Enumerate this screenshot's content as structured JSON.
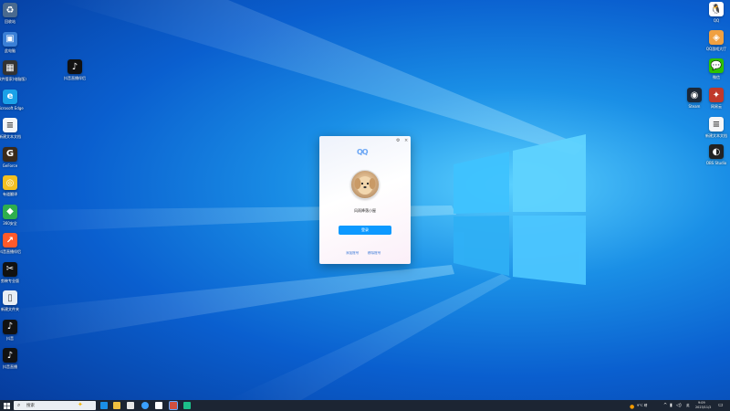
{
  "desktop_left": [
    {
      "label": "回收站",
      "color": "#4a6a8f",
      "glyph": "♻"
    },
    {
      "label": "此电脑",
      "color": "#3a7fd6",
      "glyph": "▣"
    },
    {
      "label": "Lo软件管家(电脑版)",
      "color": "#333333",
      "glyph": "▦"
    },
    {
      "label": "Microsoft Edge",
      "color": "#1aa1e8",
      "glyph": "e"
    },
    {
      "label": "新建文本文档",
      "color": "#f4f6f8",
      "glyph": "≡"
    },
    {
      "label": "GeForce",
      "color": "#3a2a1a",
      "glyph": "G"
    },
    {
      "label": "有道翻译",
      "color": "#f4c020",
      "glyph": "◎"
    },
    {
      "label": "360安全",
      "color": "#2fae4e",
      "glyph": "◆"
    },
    {
      "label": "抖音直播伴侣",
      "color": "#ff5a2a",
      "glyph": "↗"
    },
    {
      "label": "剪映专业版",
      "color": "#111111",
      "glyph": "✂"
    },
    {
      "label": "新建文件夹",
      "color": "#e8eef4",
      "glyph": "▯"
    },
    {
      "label": "抖音",
      "color": "#111111",
      "glyph": "♪"
    },
    {
      "label": "抖音直播",
      "color": "#111111",
      "glyph": "♪"
    }
  ],
  "desktop_extra": {
    "label": "抖音直播伴侣",
    "color": "#111111",
    "glyph": "♪"
  },
  "desktop_right": [
    {
      "label": "QQ",
      "color": "#ffffff",
      "glyph": "🐧"
    },
    {
      "label": "QQ游戏大厅",
      "color": "#f0a040",
      "glyph": "◈"
    },
    {
      "label": "微信",
      "color": "#2dc100",
      "glyph": "💬"
    },
    {
      "label": "Steam",
      "color": "#1b2838",
      "glyph": "◉"
    },
    {
      "label": "网易云",
      "color": "#c0392b",
      "glyph": "✦"
    },
    {
      "label": "新建文本文档",
      "color": "#f4f6f8",
      "glyph": "≡"
    },
    {
      "label": "OBS Studio",
      "color": "#222222",
      "glyph": "◐"
    }
  ],
  "qq_window": {
    "logo": "QQ",
    "settings_icon": "⚙",
    "close_icon": "×",
    "nickname": "风雨降落小屋",
    "login_button": "登录",
    "link_add": "添加账号",
    "link_remove": "移除账号"
  },
  "taskbar": {
    "search_placeholder": "搜索",
    "weather": "9°C 晴",
    "ime": "英",
    "time": "9:09",
    "date": "2023/11/2"
  }
}
